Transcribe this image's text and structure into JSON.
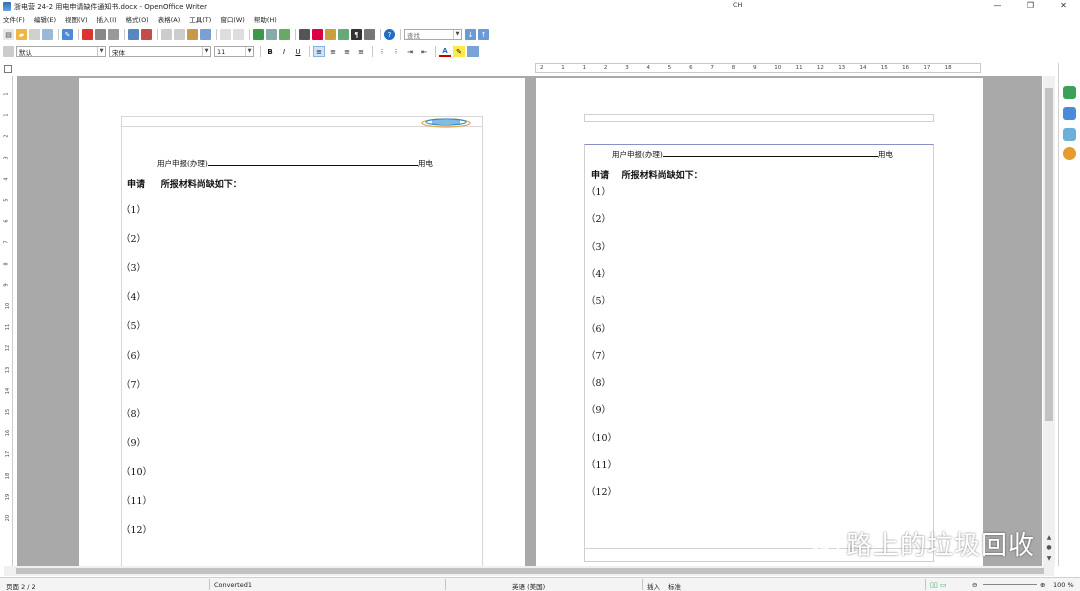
{
  "window": {
    "title": "浙电营 24-2 用电申请缺件通知书.docx - OpenOffice Writer",
    "ime": "CH",
    "controls": [
      "—",
      "❐",
      "✕"
    ]
  },
  "menu": [
    "文件(F)",
    "编辑(E)",
    "视图(V)",
    "插入(I)",
    "格式(O)",
    "表格(A)",
    "工具(T)",
    "窗口(W)",
    "帮助(H)"
  ],
  "toolbar": {
    "search_placeholder": "查找"
  },
  "format_bar": {
    "style": "默认",
    "font": "宋体",
    "size": "11",
    "bold": "B",
    "italic": "I",
    "underline": "U"
  },
  "ruler": {
    "h_ticks": [
      "2",
      "1",
      "1",
      "2",
      "3",
      "4",
      "5",
      "6",
      "7",
      "8",
      "9",
      "10",
      "11",
      "12",
      "13",
      "14",
      "15",
      "16",
      "17",
      "18"
    ],
    "v_ticks": [
      "1",
      "1",
      "2",
      "3",
      "4",
      "5",
      "6",
      "7",
      "8",
      "9",
      "10",
      "11",
      "12",
      "13",
      "14",
      "15",
      "16",
      "17",
      "18",
      "19",
      "20"
    ]
  },
  "document": {
    "header_left": "用户申报(办理)",
    "header_right": "用电",
    "apply_prefix": "申请",
    "apply_text": "所报材料尚缺如下：",
    "items": [
      "（1）",
      "（2）",
      "（3）",
      "（4）",
      "（5）",
      "（6）",
      "（7）",
      "（8）",
      "（9）",
      "（10）",
      "（11）",
      "（12）"
    ]
  },
  "status": {
    "page": "页面 2 / 2",
    "style": "Converted1",
    "language": "英语 (美国)",
    "insert": "插入",
    "std": "标准",
    "zoom": "100 %"
  },
  "watermark": "路上的垃圾回收",
  "colors": {
    "workspace": "#a9a9a9",
    "accent": "#1f6fc5"
  }
}
